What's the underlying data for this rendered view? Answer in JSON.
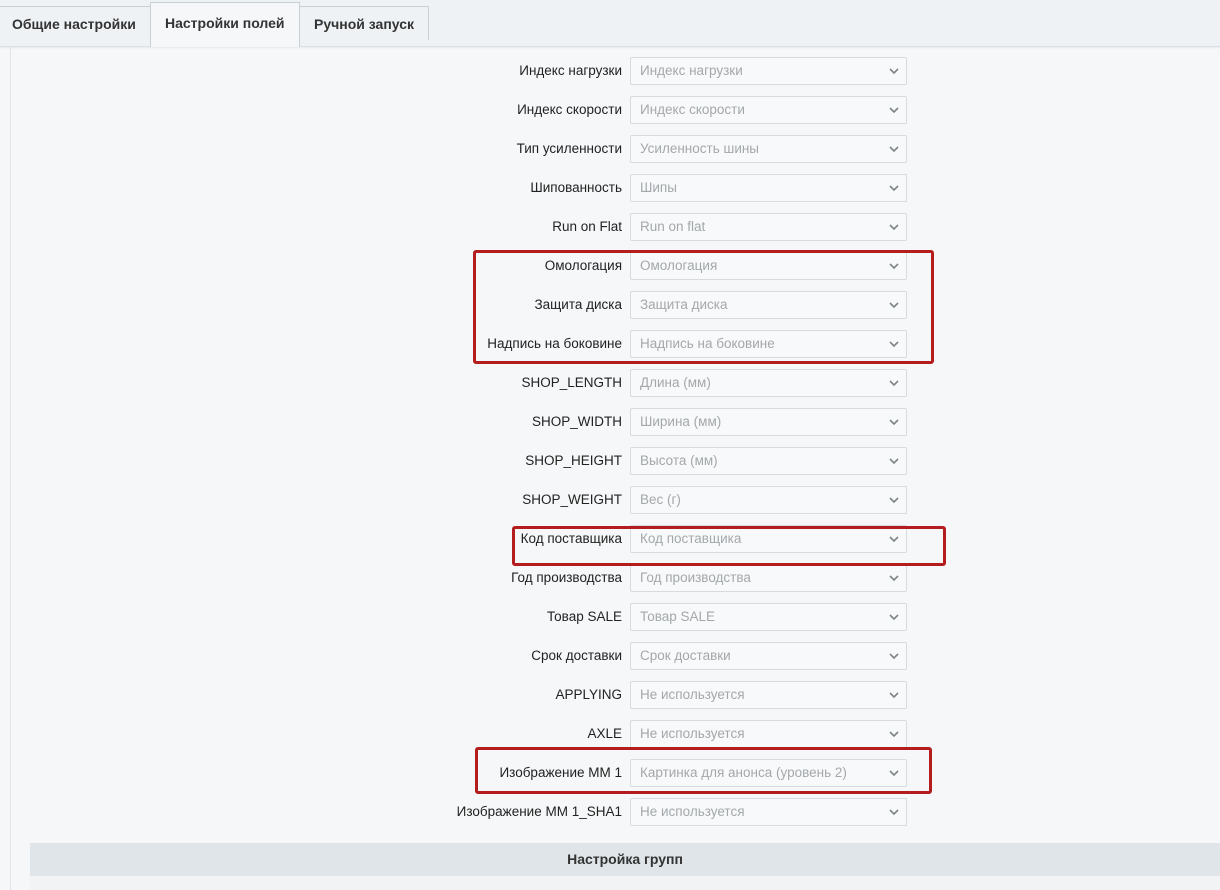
{
  "tabs": [
    {
      "label": "Общие настройки"
    },
    {
      "label": "Настройки полей"
    },
    {
      "label": "Ручной запуск"
    }
  ],
  "fields": [
    {
      "label": "Индекс нагрузки",
      "value": "Индекс нагрузки"
    },
    {
      "label": "Индекс скорости",
      "value": "Индекс скорости"
    },
    {
      "label": "Тип усиленности",
      "value": "Усиленность шины"
    },
    {
      "label": "Шипованность",
      "value": "Шипы"
    },
    {
      "label": "Run on Flat",
      "value": "Run on flat"
    },
    {
      "label": "Омологация",
      "value": "Омологация"
    },
    {
      "label": "Защита диска",
      "value": "Защита диска"
    },
    {
      "label": "Надпись на боковине",
      "value": "Надпись на боковине"
    },
    {
      "label": "SHOP_LENGTH",
      "value": "Длина (мм)"
    },
    {
      "label": "SHOP_WIDTH",
      "value": "Ширина (мм)"
    },
    {
      "label": "SHOP_HEIGHT",
      "value": "Высота (мм)"
    },
    {
      "label": "SHOP_WEIGHT",
      "value": "Вес (г)"
    },
    {
      "label": "Код поставщика",
      "value": "Код поставщика"
    },
    {
      "label": "Год производства",
      "value": "Год производства"
    },
    {
      "label": "Товар SALE",
      "value": "Товар SALE"
    },
    {
      "label": "Срок доставки",
      "value": "Срок доставки"
    },
    {
      "label": "APPLYING",
      "value": "Не используется"
    },
    {
      "label": "AXLE",
      "value": "Не используется"
    },
    {
      "label": "Изображение MM 1",
      "value": "Картинка для анонса (уровень 2)"
    },
    {
      "label": "Изображение MM 1_SHA1",
      "value": "Не используется"
    }
  ],
  "group_settings": {
    "title": "Настройка групп"
  },
  "colors": {
    "highlight": "#b31d1d",
    "placeholder_text": "#a3a8ab",
    "background": "#f5f7f8"
  }
}
